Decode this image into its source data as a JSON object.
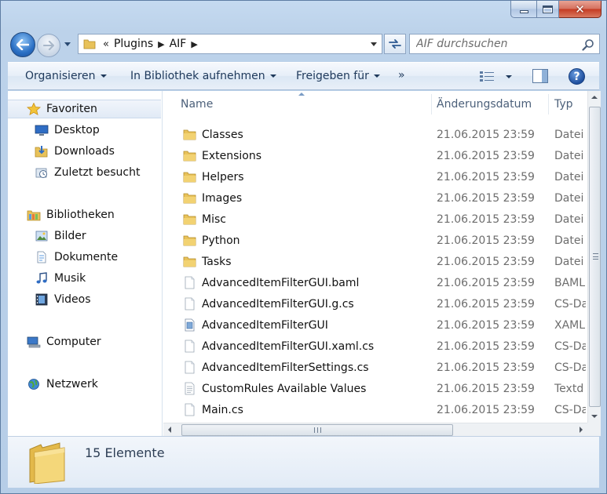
{
  "window": {
    "caption_buttons": {
      "minimize": "minimize",
      "maximize": "maximize",
      "close": "✕"
    }
  },
  "address_bar": {
    "overflow_chevron": "«",
    "crumbs": [
      "Plugins",
      "AIF"
    ],
    "separator": "▶"
  },
  "search": {
    "placeholder": "AIF durchsuchen"
  },
  "toolbar": {
    "organize": "Organisieren",
    "include_library": "In Bibliothek aufnehmen",
    "share": "Freigeben für",
    "more": "»",
    "help": "?"
  },
  "nav_pane": {
    "favorites": {
      "label": "Favoriten",
      "icon": "star-icon"
    },
    "favorite_items": [
      {
        "label": "Desktop",
        "icon": "desktop-icon"
      },
      {
        "label": "Downloads",
        "icon": "downloads-folder-icon"
      },
      {
        "label": "Zuletzt besucht",
        "icon": "recent-places-icon"
      }
    ],
    "libraries": {
      "label": "Bibliotheken",
      "icon": "libraries-icon"
    },
    "library_items": [
      {
        "label": "Bilder",
        "icon": "pictures-icon"
      },
      {
        "label": "Dokumente",
        "icon": "documents-icon"
      },
      {
        "label": "Musik",
        "icon": "music-icon"
      },
      {
        "label": "Videos",
        "icon": "videos-icon"
      }
    ],
    "computer": {
      "label": "Computer",
      "icon": "computer-icon"
    },
    "network": {
      "label": "Netzwerk",
      "icon": "network-icon"
    }
  },
  "columns": {
    "name": "Name",
    "date": "Änderungsdatum",
    "type": "Typ"
  },
  "files": [
    {
      "name": "Classes",
      "date": "21.06.2015 23:59",
      "type": "Datei",
      "icon": "folder-icon"
    },
    {
      "name": "Extensions",
      "date": "21.06.2015 23:59",
      "type": "Datei",
      "icon": "folder-icon"
    },
    {
      "name": "Helpers",
      "date": "21.06.2015 23:59",
      "type": "Datei",
      "icon": "folder-icon"
    },
    {
      "name": "Images",
      "date": "21.06.2015 23:59",
      "type": "Datei",
      "icon": "folder-icon"
    },
    {
      "name": "Misc",
      "date": "21.06.2015 23:59",
      "type": "Datei",
      "icon": "folder-icon"
    },
    {
      "name": "Python",
      "date": "21.06.2015 23:59",
      "type": "Datei",
      "icon": "folder-icon"
    },
    {
      "name": "Tasks",
      "date": "21.06.2015 23:59",
      "type": "Datei",
      "icon": "folder-icon"
    },
    {
      "name": "AdvancedItemFilterGUI.baml",
      "date": "21.06.2015 23:59",
      "type": "BAML",
      "icon": "file-icon"
    },
    {
      "name": "AdvancedItemFilterGUI.g.cs",
      "date": "21.06.2015 23:59",
      "type": "CS-Da",
      "icon": "file-icon"
    },
    {
      "name": "AdvancedItemFilterGUI",
      "date": "21.06.2015 23:59",
      "type": "XAML",
      "icon": "xaml-file-icon"
    },
    {
      "name": "AdvancedItemFilterGUI.xaml.cs",
      "date": "21.06.2015 23:59",
      "type": "CS-Da",
      "icon": "file-icon"
    },
    {
      "name": "AdvancedItemFilterSettings.cs",
      "date": "21.06.2015 23:59",
      "type": "CS-Da",
      "icon": "file-icon"
    },
    {
      "name": "CustomRules Available Values",
      "date": "21.06.2015 23:59",
      "type": "Textd",
      "icon": "text-file-icon"
    },
    {
      "name": "Main.cs",
      "date": "21.06.2015 23:59",
      "type": "CS-Da",
      "icon": "file-icon"
    }
  ],
  "details": {
    "count_text": "15 Elemente",
    "icon": "folder-icon"
  }
}
